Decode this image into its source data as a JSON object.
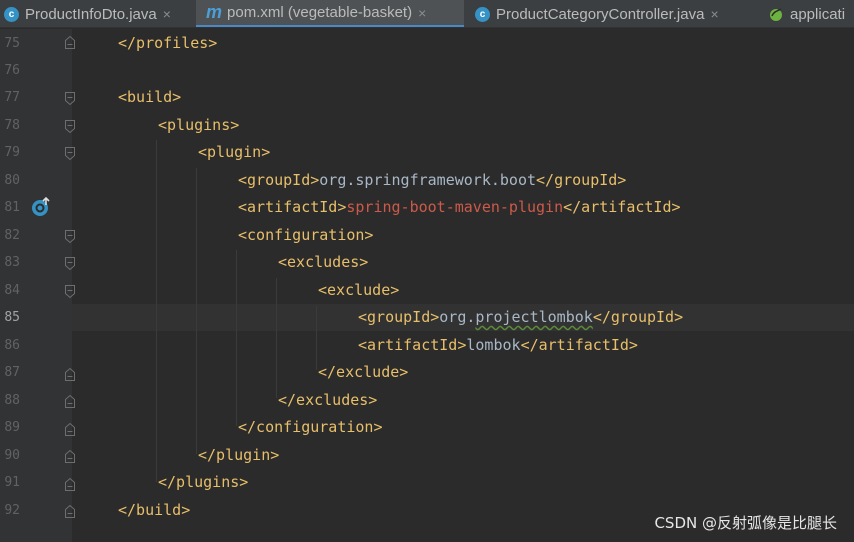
{
  "tabs": [
    {
      "label": "ProductInfoDto.java",
      "icon": "java-class-icon",
      "close": "×"
    },
    {
      "label": "pom.xml (vegetable-basket)",
      "icon": "maven-icon",
      "close": "×"
    },
    {
      "label": "ProductCategoryController.java",
      "icon": "java-class-icon",
      "close": "×"
    },
    {
      "label": "applicati",
      "icon": "spring-icon"
    }
  ],
  "icons": {
    "class_letter": "c",
    "maven_letter": "m"
  },
  "line_numbers": [
    "75",
    "76",
    "77",
    "78",
    "79",
    "80",
    "81",
    "82",
    "83",
    "84",
    "85",
    "86",
    "87",
    "88",
    "89",
    "90",
    "91",
    "92"
  ],
  "current_line": "85",
  "code": {
    "l75": {
      "t1": "</profiles>"
    },
    "l77": {
      "t1": "<build>"
    },
    "l78": {
      "t1": "<plugins>"
    },
    "l79": {
      "t1": "<plugin>"
    },
    "l80": {
      "t1": "<groupId>",
      "v": "org.springframework.boot",
      "t2": "</groupId>"
    },
    "l81": {
      "t1": "<artifactId>",
      "v": "spring-boot-maven-plugin",
      "t2": "</artifactId>"
    },
    "l82": {
      "t1": "<configuration>"
    },
    "l83": {
      "t1": "<excludes>"
    },
    "l84": {
      "t1": "<exclude>"
    },
    "l85": {
      "t1": "<groupId>",
      "v1": "org.",
      "v2": "projectlombok",
      "t2": "</groupId>"
    },
    "l86": {
      "t1": "<artifactId>",
      "v": "lombok",
      "t2": "</artifactId>"
    },
    "l87": {
      "t1": "</exclude>"
    },
    "l88": {
      "t1": "</excludes>"
    },
    "l89": {
      "t1": "</configuration>"
    },
    "l90": {
      "t1": "</plugin>"
    },
    "l91": {
      "t1": "</plugins>"
    },
    "l92": {
      "t1": "</build>"
    }
  },
  "watermark": "CSDN @反射弧像是比腿长",
  "colors": {
    "tag": "#e8bf6a",
    "text": "#a9b7c6",
    "artifact_value": "#cc5a4a",
    "background": "#2b2b2b"
  }
}
